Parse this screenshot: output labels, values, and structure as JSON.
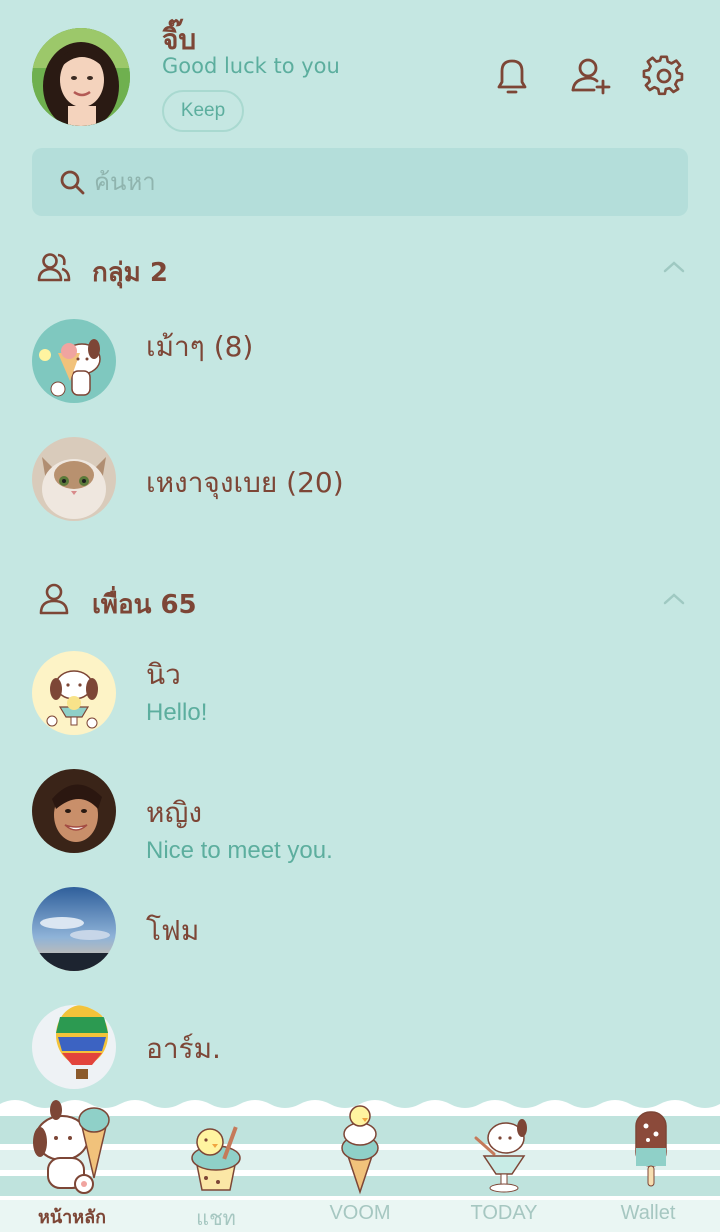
{
  "profile": {
    "name": "จิ๊บ",
    "status": "Good luck to you",
    "keep_label": "Keep"
  },
  "search": {
    "placeholder": "ค้นหา"
  },
  "groups": {
    "label": "กลุ่ม 2",
    "items": [
      {
        "name": "เม้าๆ (8)"
      },
      {
        "name": "เหงาจุงเบย (20)"
      }
    ]
  },
  "friends": {
    "label": "เพื่อน 65",
    "items": [
      {
        "name": "นิว",
        "message": "Hello!"
      },
      {
        "name": "หญิง",
        "message": "Nice to meet you."
      },
      {
        "name": "โฟม"
      },
      {
        "name": "อาร์ม."
      }
    ]
  },
  "tabs": [
    {
      "label": "หน้าหลัก",
      "active": true
    },
    {
      "label": "แชท"
    },
    {
      "label": "VOOM"
    },
    {
      "label": "TODAY"
    },
    {
      "label": "Wallet"
    }
  ],
  "colors": {
    "background": "#c5e7e2",
    "text_brown": "#7d4636",
    "accent_teal": "#5cae9e",
    "search_bg": "#b4deda"
  }
}
